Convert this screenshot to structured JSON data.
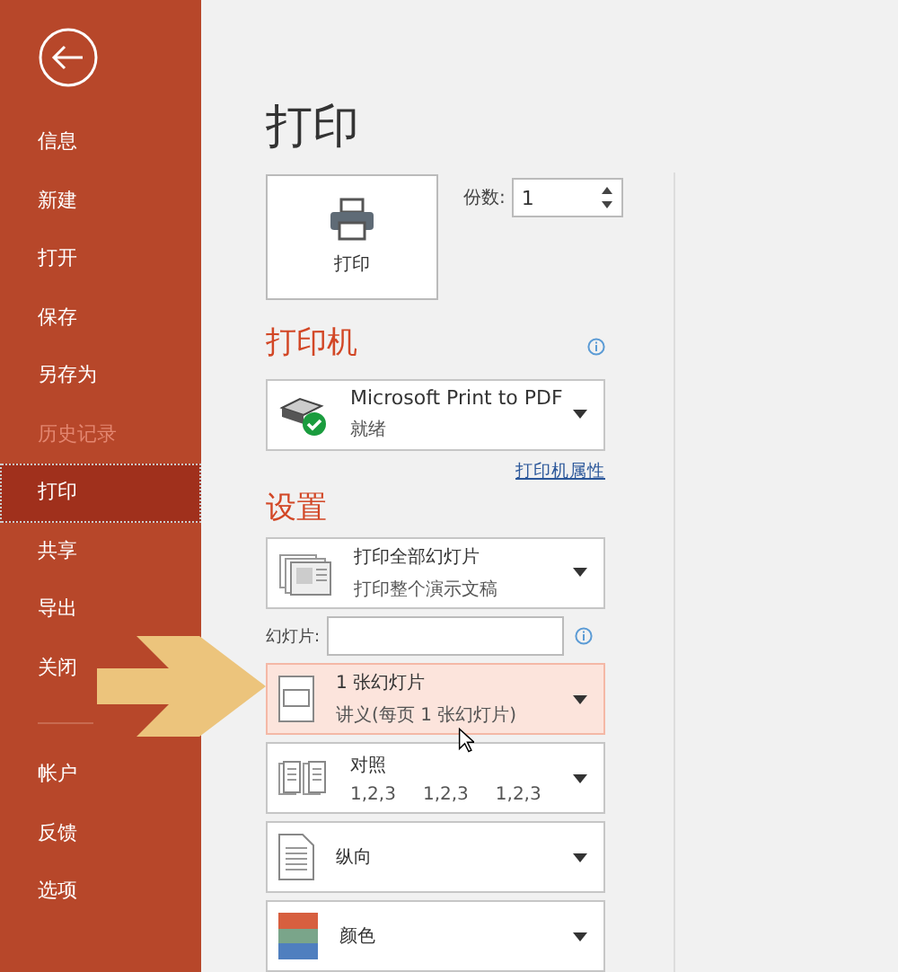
{
  "sidebar": {
    "items": [
      {
        "label": "信息",
        "selected": false,
        "disabled": false
      },
      {
        "label": "新建",
        "selected": false,
        "disabled": false
      },
      {
        "label": "打开",
        "selected": false,
        "disabled": false
      },
      {
        "label": "保存",
        "selected": false,
        "disabled": false
      },
      {
        "label": "另存为",
        "selected": false,
        "disabled": false
      },
      {
        "label": "历史记录",
        "selected": false,
        "disabled": true
      },
      {
        "label": "打印",
        "selected": true,
        "disabled": false
      },
      {
        "label": "共享",
        "selected": false,
        "disabled": false
      },
      {
        "label": "导出",
        "selected": false,
        "disabled": false
      },
      {
        "label": "关闭",
        "selected": false,
        "disabled": false
      }
    ],
    "bottom_items": [
      {
        "label": "帐户",
        "selected": false,
        "disabled": false
      },
      {
        "label": "反馈",
        "selected": false,
        "disabled": false
      },
      {
        "label": "选项",
        "selected": false,
        "disabled": false
      }
    ]
  },
  "title": "打印",
  "print_button": {
    "label": "打印"
  },
  "copies": {
    "label": "份数:",
    "value": "1"
  },
  "printer": {
    "heading": "打印机",
    "name": "Microsoft Print to PDF",
    "status": "就绪",
    "properties_link": "打印机属性"
  },
  "settings": {
    "heading": "设置",
    "items": [
      {
        "kind": "slides",
        "title": "打印全部幻灯片",
        "subtitle": "打印整个演示文稿",
        "hovered": false
      },
      {
        "kind": "range",
        "label": "幻灯片:"
      },
      {
        "kind": "layout",
        "title": "1 张幻灯片",
        "subtitle": "讲义(每页 1 张幻灯片)",
        "hovered": true
      },
      {
        "kind": "collate",
        "title": "对照",
        "subtitle_parts": [
          "1,2,3",
          "1,2,3",
          "1,2,3"
        ],
        "hovered": false
      },
      {
        "kind": "orientation",
        "title": "纵向",
        "hovered": false
      },
      {
        "kind": "color",
        "title": "颜色",
        "hovered": false
      }
    ]
  }
}
